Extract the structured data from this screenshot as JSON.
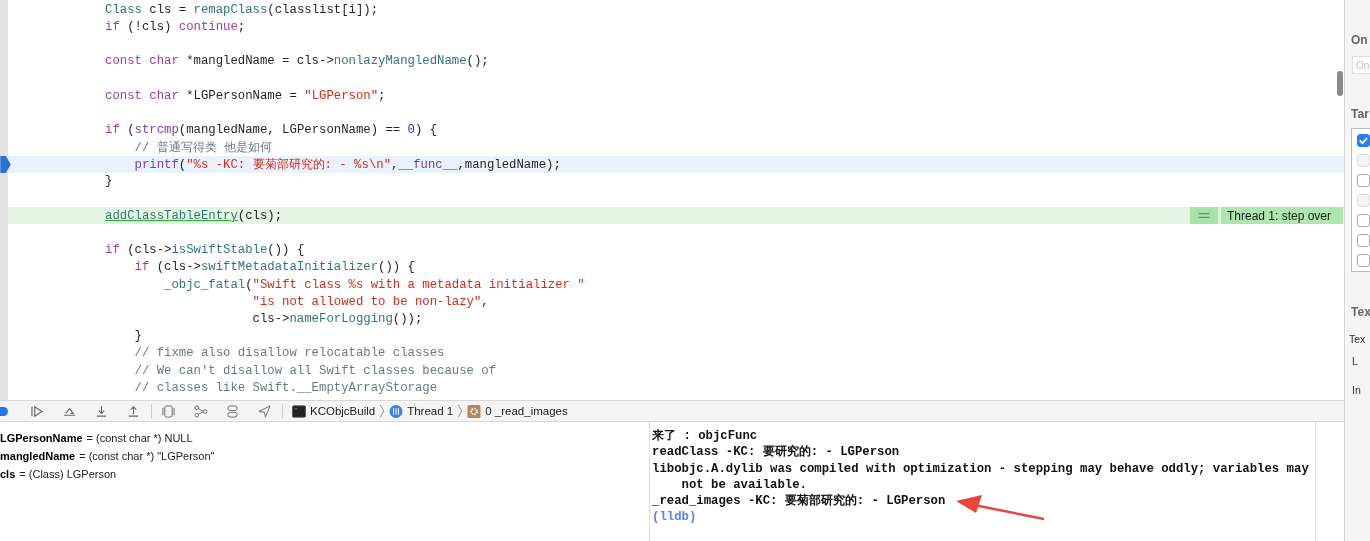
{
  "editor": {
    "lines": [
      {
        "current": false,
        "stepped": false,
        "tokens": [
          {
            "text": "Class",
            "kind": "type"
          },
          {
            "text": " cls = ",
            "kind": "plain"
          },
          {
            "text": "remapClass",
            "kind": "func"
          },
          {
            "text": "(classlist[i]);",
            "kind": "plain"
          }
        ]
      },
      {
        "current": false,
        "stepped": false,
        "tokens": [
          {
            "text": "if",
            "kind": "keyword"
          },
          {
            "text": " (!cls) ",
            "kind": "plain"
          },
          {
            "text": "continue",
            "kind": "keyword"
          },
          {
            "text": ";",
            "kind": "plain"
          }
        ]
      },
      {
        "current": false,
        "stepped": false
      },
      {
        "current": false,
        "stepped": false,
        "tokens": [
          {
            "text": "const char",
            "kind": "keyword"
          },
          {
            "text": " *mangledName = cls->",
            "kind": "plain"
          },
          {
            "text": "nonlazyMangledName",
            "kind": "func"
          },
          {
            "text": "();",
            "kind": "plain"
          }
        ]
      },
      {
        "current": false,
        "stepped": false
      },
      {
        "current": false,
        "stepped": false,
        "tokens": [
          {
            "text": "const char",
            "kind": "keyword"
          },
          {
            "text": " *LGPersonName = ",
            "kind": "plain"
          },
          {
            "text": "\"LGPerson\"",
            "kind": "string"
          },
          {
            "text": ";",
            "kind": "plain"
          }
        ]
      },
      {
        "current": false,
        "stepped": false
      },
      {
        "current": false,
        "stepped": false,
        "tokens": [
          {
            "text": "if",
            "kind": "keyword"
          },
          {
            "text": " (",
            "kind": "plain"
          },
          {
            "text": "strcmp",
            "kind": "libfunc"
          },
          {
            "text": "(mangledName, LGPersonName) == ",
            "kind": "plain"
          },
          {
            "text": "0",
            "kind": "number"
          },
          {
            "text": ") {",
            "kind": "plain"
          }
        ]
      },
      {
        "current": false,
        "stepped": false,
        "tokens": [
          {
            "text": "    // 普通写得类 他是如何",
            "kind": "comment"
          }
        ]
      },
      {
        "current": true,
        "stepped": false,
        "tokens": [
          {
            "text": "    printf",
            "kind": "libfunc"
          },
          {
            "text": "(",
            "kind": "plain"
          },
          {
            "text": "\"%s -KC: 要菊部研究的: - %s\\n\"",
            "kind": "string"
          },
          {
            "text": ",",
            "kind": "plain"
          },
          {
            "text": "__func__",
            "kind": "macro"
          },
          {
            "text": ",mangledName);",
            "kind": "plain"
          }
        ]
      },
      {
        "current": false,
        "stepped": false,
        "tokens": [
          {
            "text": "}",
            "kind": "plain"
          }
        ]
      },
      {
        "current": false,
        "stepped": false
      },
      {
        "current": false,
        "stepped": true,
        "annotation": "Thread 1: step over",
        "tokens": [
          {
            "text": "addClassTableEntry",
            "kind": "func_underlined"
          },
          {
            "text": "(cls);",
            "kind": "plain"
          }
        ]
      },
      {
        "current": false,
        "stepped": false
      },
      {
        "current": false,
        "stepped": false,
        "tokens": [
          {
            "text": "if",
            "kind": "keyword"
          },
          {
            "text": " (cls->",
            "kind": "plain"
          },
          {
            "text": "isSwiftStable",
            "kind": "func"
          },
          {
            "text": "()) {",
            "kind": "plain"
          }
        ]
      },
      {
        "current": false,
        "stepped": false,
        "tokens": [
          {
            "text": "    if",
            "kind": "keyword"
          },
          {
            "text": " (cls->",
            "kind": "plain"
          },
          {
            "text": "swiftMetadataInitializer",
            "kind": "func"
          },
          {
            "text": "()) {",
            "kind": "plain"
          }
        ]
      },
      {
        "current": false,
        "stepped": false,
        "tokens": [
          {
            "text": "        _objc_fatal",
            "kind": "func"
          },
          {
            "text": "(",
            "kind": "plain"
          },
          {
            "text": "\"Swift class %s with a metadata initializer \"",
            "kind": "string"
          }
        ]
      },
      {
        "current": false,
        "stepped": false,
        "tokens": [
          {
            "text": "                    \"is not allowed to be non-lazy\"",
            "kind": "string"
          },
          {
            "text": ",",
            "kind": "plain"
          }
        ]
      },
      {
        "current": false,
        "stepped": false,
        "tokens": [
          {
            "text": "                    cls->",
            "kind": "plain"
          },
          {
            "text": "nameForLogging",
            "kind": "func"
          },
          {
            "text": "());",
            "kind": "plain"
          }
        ]
      },
      {
        "current": false,
        "stepped": false,
        "tokens": [
          {
            "text": "    }",
            "kind": "plain"
          }
        ]
      },
      {
        "current": false,
        "stepped": false,
        "tokens": [
          {
            "text": "    // fixme also disallow relocatable classes",
            "kind": "comment"
          }
        ]
      },
      {
        "current": false,
        "stepped": false,
        "tokens": [
          {
            "text": "    // We can't disallow all Swift classes because of",
            "kind": "comment"
          }
        ]
      },
      {
        "current": false,
        "stepped": false,
        "tokens": [
          {
            "text": "    // classes like Swift.__EmptyArrayStorage",
            "kind": "comment"
          }
        ]
      }
    ]
  },
  "debug_bar": {
    "breadcrumbs": [
      {
        "label": "KCObjcBuild",
        "kind": "target"
      },
      {
        "label": "Thread 1",
        "kind": "thread"
      },
      {
        "label": "0 _read_images",
        "kind": "frame"
      }
    ]
  },
  "variables": [
    {
      "name": "LGPersonName",
      "summary": "= (const char *) NULL"
    },
    {
      "name": "mangledName",
      "summary": "= (const char *) \"LGPerson\""
    },
    {
      "name": "cls",
      "summary": "= (Class) LGPerson"
    }
  ],
  "console": [
    {
      "text": "来了 : objcFunc",
      "kind": "output"
    },
    {
      "text": "readClass -KC: 要研究的: - LGPerson",
      "kind": "output"
    },
    {
      "text": "libobjc.A.dylib was compiled with optimization - stepping may behave oddly; variables may not be available.",
      "kind": "output"
    },
    {
      "text": "_read_images -KC: 要菊部研究的: - LGPerson",
      "kind": "output"
    },
    {
      "text": "(lldb)",
      "kind": "prompt"
    }
  ],
  "inspector": {
    "heading_1": "On",
    "field_placeholder": "On",
    "heading_2": "Tar",
    "targets": [
      {
        "checked": true,
        "disabled": false
      },
      {
        "checked": false,
        "disabled": true
      },
      {
        "checked": false,
        "disabled": false
      },
      {
        "checked": false,
        "disabled": true
      },
      {
        "checked": false,
        "disabled": false
      },
      {
        "checked": false,
        "disabled": false
      },
      {
        "checked": false,
        "disabled": false
      }
    ],
    "heading_3": "Tex",
    "labels": [
      "Tex",
      "L",
      "In"
    ]
  }
}
